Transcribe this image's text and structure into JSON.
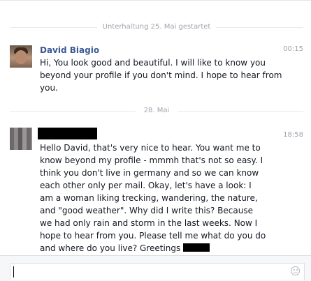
{
  "conversation": {
    "started_label": "Unterhaltung 25. Mai gestartet",
    "date_divider": "28. Mai"
  },
  "messages": [
    {
      "sender": "David Biagio",
      "time": "00:15",
      "text": "Hi, You look good and beautiful. I will like to know you beyond your profile if you don't mind. I hope to hear from you."
    },
    {
      "sender": "",
      "time": "18:58",
      "text": "Hello David, that's very nice to hear. You want me to know beyond my profile - mmmh that's not so easy. I think you don't live in germany and so we can know each other only per mail. Okay, let's have a look: I am a woman liking trecking, wandering, the nature, and \"good weather\". Why did I write this? Because we had only rain and storm in the last weeks. Now I hope to hear from you. Please tell me what do you do and where do you live? Greetings"
    }
  ],
  "composer": {
    "value": "",
    "emoji_icon": "smiley-icon"
  }
}
